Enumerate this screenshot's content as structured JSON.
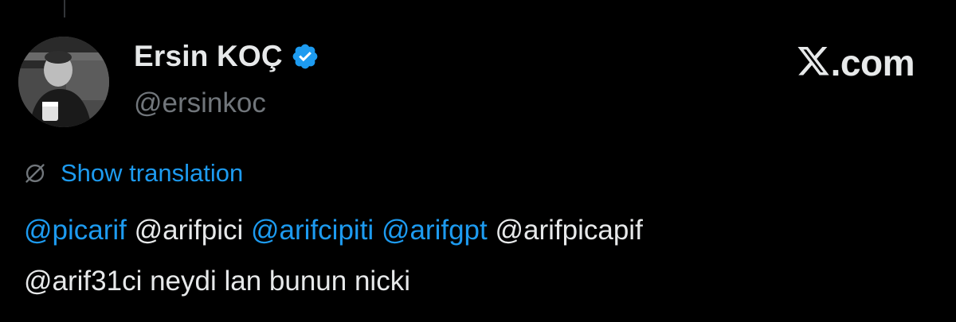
{
  "author": {
    "display_name": "Ersin KOÇ",
    "handle": "@ersinkoc",
    "verified": true,
    "avatar_icon": "avatar-photo"
  },
  "brand": {
    "logo_icon": "x-logo-icon",
    "text": ".com"
  },
  "translation": {
    "icon": "globe-slash-icon",
    "label": "Show translation"
  },
  "tweet": {
    "line1": [
      {
        "text": "@picarif",
        "type": "link"
      },
      {
        "text": " @arifpici ",
        "type": "plain"
      },
      {
        "text": "@arifcipiti",
        "type": "link"
      },
      {
        "text": " ",
        "type": "plain"
      },
      {
        "text": "@arifgpt",
        "type": "link"
      },
      {
        "text": " @arifpicapif",
        "type": "plain"
      }
    ],
    "line2": [
      {
        "text": "@arif31ci neydi lan bunun nicki",
        "type": "plain"
      }
    ]
  },
  "colors": {
    "background": "#000000",
    "text_primary": "#e7e9ea",
    "text_secondary": "#71767b",
    "accent": "#1d9bf0"
  }
}
